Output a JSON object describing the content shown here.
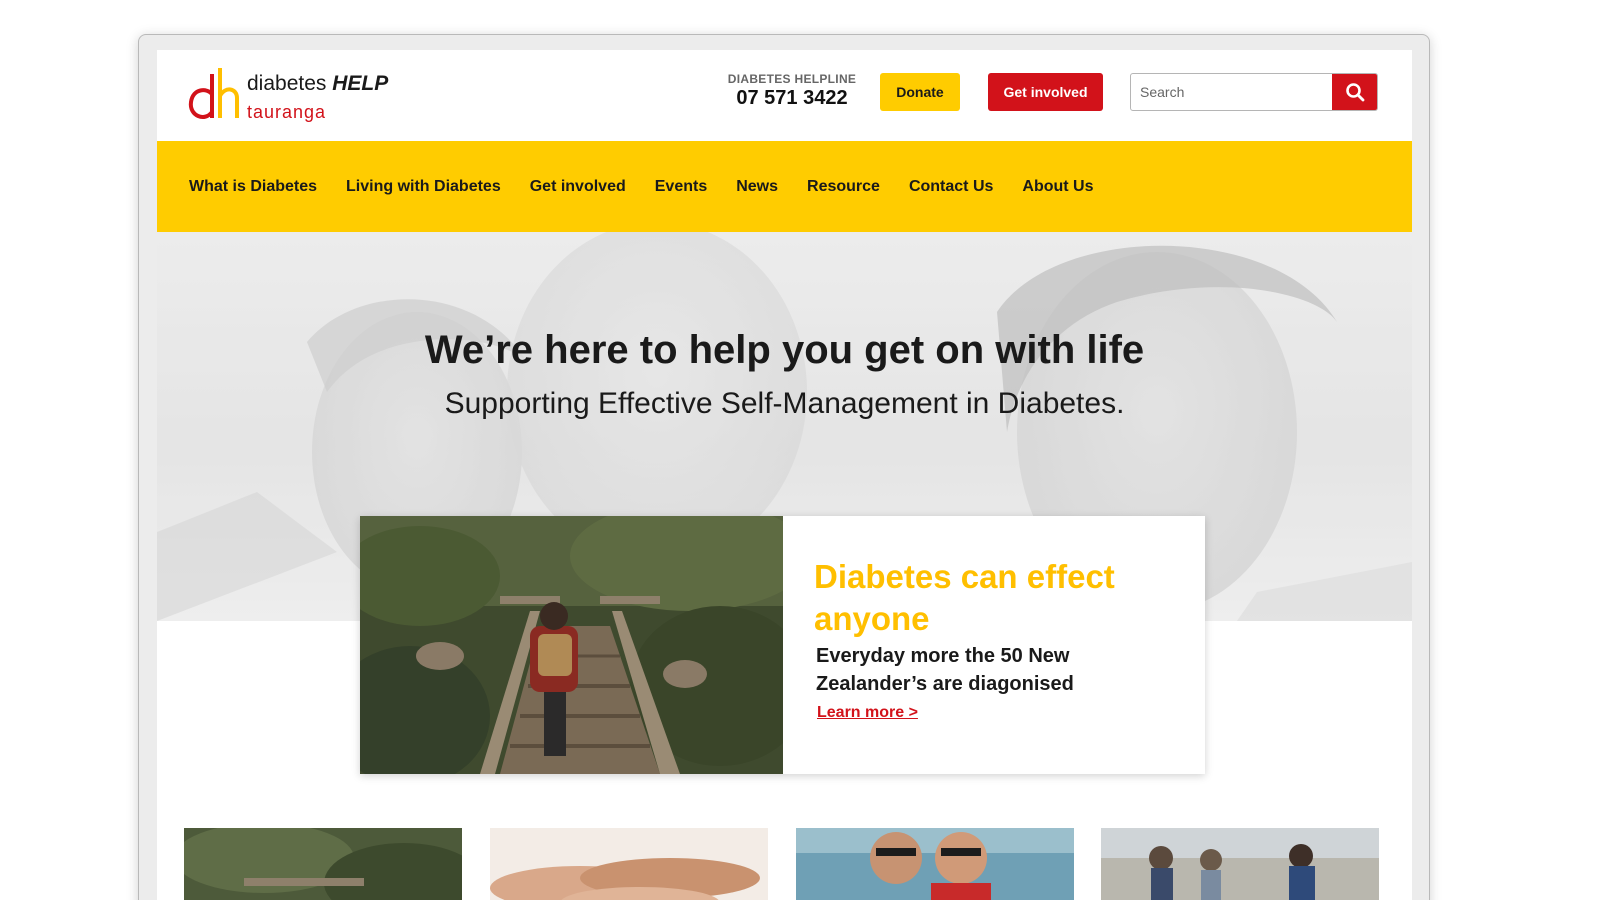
{
  "brand": {
    "name_line1": "diabetes",
    "name_line1_emphasis": "HELP",
    "name_line2": "tauranga",
    "colors": {
      "yellow": "#ffcc00",
      "red": "#d2121a",
      "heading_yellow": "#ffbf00"
    }
  },
  "header": {
    "helpline_label": "DIABETES HELPLINE",
    "helpline_number": "07 571 3422",
    "donate_label": "Donate",
    "get_involved_label": "Get involved",
    "search_placeholder": "Search",
    "search_icon": "search-icon"
  },
  "nav": {
    "items": [
      {
        "label": "What is Diabetes"
      },
      {
        "label": "Living with Diabetes"
      },
      {
        "label": "Get involved"
      },
      {
        "label": "Events"
      },
      {
        "label": "News"
      },
      {
        "label": "Resource"
      },
      {
        "label": "Contact Us"
      },
      {
        "label": "About Us"
      }
    ]
  },
  "hero": {
    "title": "We’re here to help you get on with life",
    "subtitle": "Supporting Effective Self-Management in Diabetes."
  },
  "feature": {
    "heading": "Diabetes can effect anyone",
    "text": "Everyday more the 50 New Zealander’s are diagonised",
    "link_label": "Learn more >"
  },
  "thumbnails": [
    {
      "image": "hiking-trail-photo"
    },
    {
      "image": "stacked-hands-photo"
    },
    {
      "image": "smiling-couple-beach-photo"
    },
    {
      "image": "group-walking-photo"
    }
  ]
}
